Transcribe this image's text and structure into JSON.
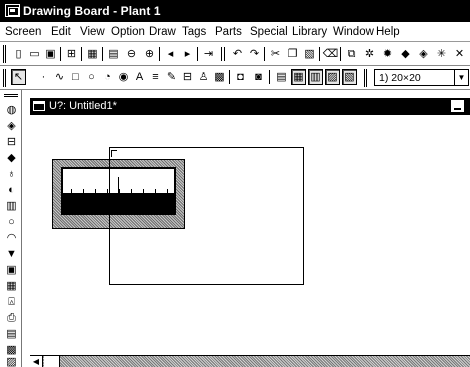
{
  "window": {
    "title": "Drawing Board - Plant 1"
  },
  "menubar": {
    "items": [
      "Screen",
      "Edit",
      "View",
      "Option",
      "Draw",
      "Tags",
      "Parts",
      "Special",
      "Library",
      "Window",
      "Help"
    ]
  },
  "toolbar1": {
    "icons": [
      "new-icon",
      "open-icon",
      "save-icon",
      "library-icon",
      "grid-icon",
      "screen-list-icon",
      "zoom-out-icon",
      "zoom-in-icon",
      "prev-screen-icon",
      "next-screen-icon",
      "go-to-icon",
      "undo-icon",
      "redo-icon",
      "cut-icon",
      "copy-icon",
      "paste-icon",
      "delete-icon",
      "duplicate-icon",
      "group-icon",
      "ungroup-icon",
      "align-icon",
      "flip-icon",
      "rotate-icon",
      "move-icon"
    ]
  },
  "toolbar2": {
    "icons": [
      "select-arrow-icon",
      "dot-icon",
      "polyline-icon",
      "rectangle-icon",
      "circle-icon",
      "arc-icon",
      "fill-icon",
      "text-icon",
      "scale-icon",
      "pen-icon",
      "image-icon",
      "person-icon",
      "picture-icon",
      "layer-front-icon",
      "layer-back-icon",
      "view-mode-1-icon",
      "view-mode-2-icon",
      "view-mode-3-icon",
      "view-mode-4-icon",
      "view-mode-5-icon"
    ],
    "zoom_value": "1) 20×20"
  },
  "left_tools": {
    "icons": [
      "part-lamp-icon",
      "part-switch-icon",
      "part-meter-icon",
      "part-tank-icon",
      "part-bulb-icon",
      "part-graph-icon",
      "part-bar-icon",
      "part-circle-icon",
      "part-arc-icon",
      "part-arrow-icon",
      "part-panel-icon",
      "part-keypad-icon",
      "part-alarm-icon",
      "part-printer-icon",
      "part-table-icon",
      "part-grid-icon",
      "part-numeric-icon"
    ]
  },
  "child_window": {
    "title": "U?: Untitled1*"
  }
}
